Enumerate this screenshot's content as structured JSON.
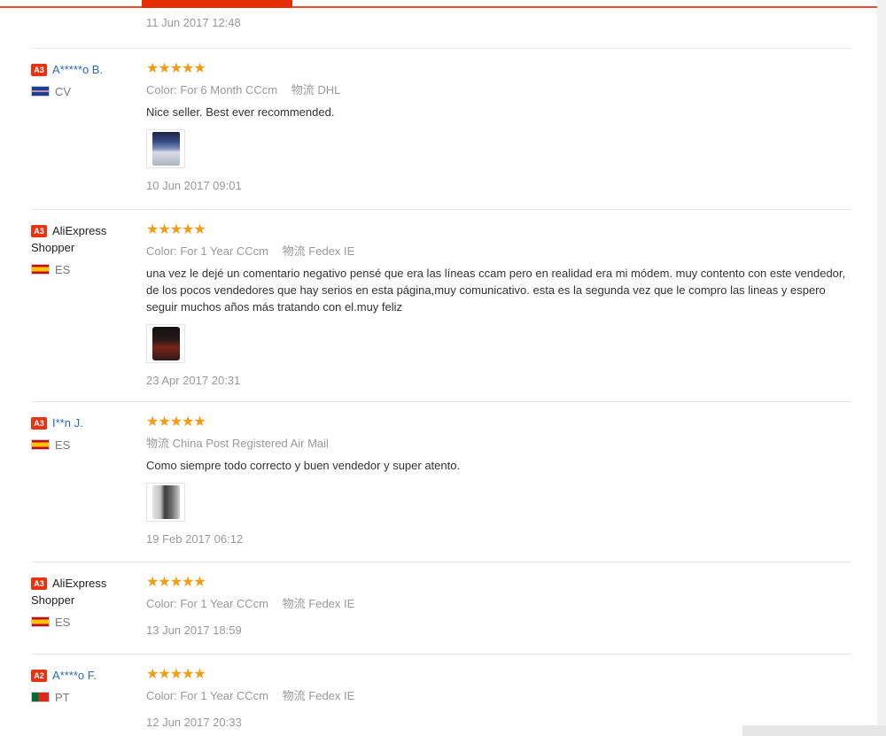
{
  "first_review_date": "11 Jun 2017 12:48",
  "stars_glyph": "★★★★★",
  "reviews": [
    {
      "level": "A3",
      "name": "A*****o B.",
      "country": "CV",
      "meta_label1": "Color:",
      "meta_value1": "For 6 Month CCcm",
      "meta_label2": "物流",
      "meta_value2": "DHL",
      "text": "Nice seller. Best ever recommended.",
      "photo": "router-photo",
      "date": "10 Jun 2017 09:01"
    },
    {
      "level": "A3",
      "name": "AliExpress Shopper",
      "country": "ES",
      "meta_label1": "Color:",
      "meta_value1": "For 1 Year CCcm",
      "meta_label2": "物流",
      "meta_value2": "Fedex IE",
      "text": "una vez le dejé un comentario negativo pensé que era las líneas ccam pero en realidad era mi módem. muy contento con este vendedor, de los pocos vendedores que hay serios en esta página,muy comunicativo. esta es la segunda vez que le compro las lineas y espero seguir muchos años más tratando con el.muy feliz",
      "photo": "phone-photo",
      "date": "23 Apr 2017 20:31"
    },
    {
      "level": "A3",
      "name": "I**n J.",
      "country": "ES",
      "meta_label2": "物流",
      "meta_value2": "China Post Registered Air Mail",
      "text": "Como siempre todo correcto y buen vendedor y super atento.",
      "photo": "device-photo",
      "date": "19 Feb 2017 06:12"
    },
    {
      "level": "A3",
      "name": "AliExpress Shopper",
      "country": "ES",
      "meta_label1": "Color:",
      "meta_value1": "For 1 Year CCcm",
      "meta_label2": "物流",
      "meta_value2": "Fedex IE",
      "date": "13 Jun 2017 18:59"
    },
    {
      "level": "A2",
      "name": "A****o F.",
      "country": "PT",
      "meta_label1": "Color:",
      "meta_value1": "For 1 Year CCcm",
      "meta_label2": "物流",
      "meta_value2": "Fedex IE",
      "date": "12 Jun 2017 20:33"
    }
  ],
  "colors": {
    "accent": "#e52e04",
    "star": "#f39c12",
    "link": "#2a6ab0",
    "level_badge": "#e63312"
  }
}
